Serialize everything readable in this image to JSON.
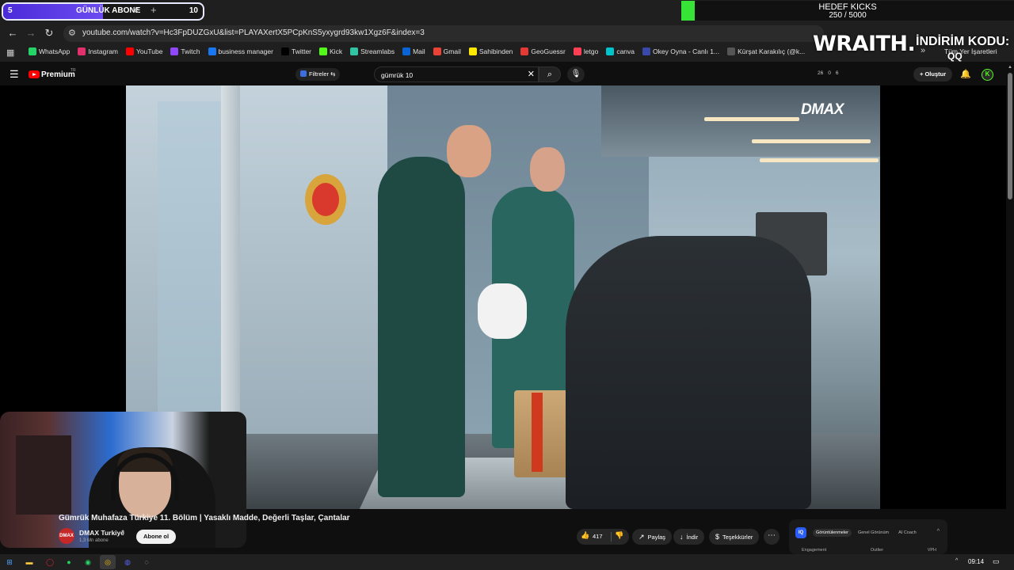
{
  "overlay": {
    "subscriber_counter": {
      "current": "5",
      "label": "GÜNLÜK ABONE",
      "goal": "10",
      "progress": 0.5
    },
    "kicks_goal": {
      "title": "HEDEF KICKS",
      "progress_text": "250 / 5000",
      "progress": 0.05
    },
    "sponsor": {
      "brand": "WRAITH.",
      "promo_label": "İNDİRİM KODU:",
      "promo_code": "QQ"
    },
    "channel_watermark": "DMAX"
  },
  "browser": {
    "tab_close_glyph": "✕",
    "new_tab_glyph": "+",
    "url": "youtube.com/watch?v=Hc3FpDUZGxU&list=PLAYAXertX5PCpKnS5yxygrd93kw1Xgz6F&index=3",
    "bookmarks": [
      {
        "label": "WhatsApp",
        "color": "#25d366"
      },
      {
        "label": "Instagram",
        "color": "#e1306c"
      },
      {
        "label": "YouTube",
        "color": "#ff0000"
      },
      {
        "label": "Twitch",
        "color": "#9146ff"
      },
      {
        "label": "business manager",
        "color": "#1877f2"
      },
      {
        "label": "Twitter",
        "color": "#000000"
      },
      {
        "label": "Kick",
        "color": "#53fc18"
      },
      {
        "label": "Streamlabs",
        "color": "#31c3a2"
      },
      {
        "label": "Mail",
        "color": "#0a64d6"
      },
      {
        "label": "Gmail",
        "color": "#ea4335"
      },
      {
        "label": "Sahibinden",
        "color": "#ffe800"
      },
      {
        "label": "GeoGuessr",
        "color": "#e53935"
      },
      {
        "label": "letgo",
        "color": "#ff3f55"
      },
      {
        "label": "canva",
        "color": "#00c4cc"
      },
      {
        "label": "Okey Oyna - Canlı 1...",
        "color": "#3949ab"
      },
      {
        "label": "Kürşat Karakılıç (@k...",
        "color": "#555555"
      }
    ],
    "bookmarks_right": "Tüm Yer İşaretleri"
  },
  "youtube": {
    "brand": "Premium",
    "country": "TR",
    "filters_label": "Filtreler",
    "search_query": "gümrük 10",
    "ext_stats": [
      "26",
      "0",
      "6"
    ],
    "create_label": "Oluştur",
    "account_initial": "K",
    "video_title": "Gümrük Muhafaza Türkiye 11. Bölüm | Yasaklı Madde, Değerli Taşlar, Çantalar",
    "channel": {
      "name": "DMAX Turkiye",
      "subscribers": "1,3 Mn abone",
      "avatar_text": "DMAX"
    },
    "subscribe_label": "Abone ol",
    "likes": "417",
    "share_label": "Paylaş",
    "download_label": "İndir",
    "thanks_label": "Teşekkürler"
  },
  "vidiq": {
    "logo": "IQ",
    "tabs": [
      "Görüntülenmeler",
      "Genel Görünüm",
      "AI Coach"
    ],
    "columns": [
      "Engagement",
      "Outlier",
      "VPH"
    ]
  },
  "taskbar": {
    "time": "09:14"
  }
}
